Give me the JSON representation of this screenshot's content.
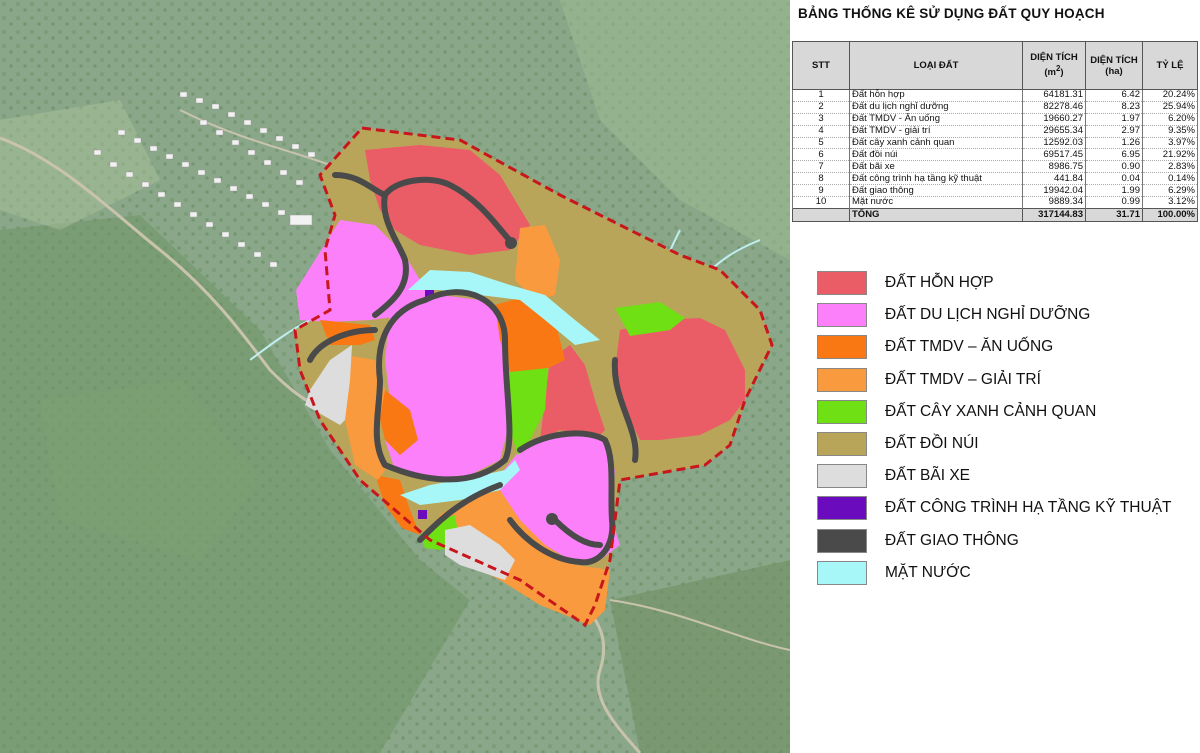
{
  "table": {
    "title": "BẢNG THỐNG KÊ SỬ DỤNG ĐẤT QUY HOẠCH",
    "headers": {
      "stt": "STT",
      "loai_dat": "LOẠI ĐẤT",
      "dien_tich_m2": "DIỆN TÍCH",
      "dien_tich_m2_unit": "(m",
      "dien_tich_m2_sup": "2",
      "dien_tich_m2_close": ")",
      "dien_tich_ha": "DIỆN TÍCH",
      "dien_tich_ha_unit": "(ha)",
      "ty_le": "TỶ LỆ"
    },
    "rows": [
      {
        "stt": "1",
        "name": "Đất hỗn hợp",
        "m2": "64181.31",
        "ha": "6.42",
        "pct": "20.24%"
      },
      {
        "stt": "2",
        "name": "Đất du lịch nghỉ dưỡng",
        "m2": "82278.46",
        "ha": "8.23",
        "pct": "25.94%"
      },
      {
        "stt": "3",
        "name": "Đất TMDV - Ăn uống",
        "m2": "19660.27",
        "ha": "1.97",
        "pct": "6.20%"
      },
      {
        "stt": "4",
        "name": "Đất TMDV - giải trí",
        "m2": "29655.34",
        "ha": "2.97",
        "pct": "9.35%"
      },
      {
        "stt": "5",
        "name": "Đất cây xanh cảnh quan",
        "m2": "12592.03",
        "ha": "1.26",
        "pct": "3.97%"
      },
      {
        "stt": "6",
        "name": "Đất đồi núi",
        "m2": "69517.45",
        "ha": "6.95",
        "pct": "21.92%"
      },
      {
        "stt": "7",
        "name": "Đất bãi xe",
        "m2": "8986.75",
        "ha": "0.90",
        "pct": "2.83%"
      },
      {
        "stt": "8",
        "name": "Đất công trình hạ tầng kỹ thuật",
        "m2": "441.84",
        "ha": "0.04",
        "pct": "0.14%"
      },
      {
        "stt": "9",
        "name": "Đất giao thông",
        "m2": "19942.04",
        "ha": "1.99",
        "pct": "6.29%"
      },
      {
        "stt": "10",
        "name": "Mặt nước",
        "m2": "9889.34",
        "ha": "0.99",
        "pct": "3.12%"
      }
    ],
    "total": {
      "label": "TỔNG",
      "m2": "317144.83",
      "ha": "31.71",
      "pct": "100.00%"
    }
  },
  "legend": [
    {
      "label": "ĐẤT HỖN HỢP",
      "color": "#ea5d67"
    },
    {
      "label": "ĐẤT DU LỊCH NGHỈ DƯỠNG",
      "color": "#fb80f9"
    },
    {
      "label": "ĐẤT TMDV – ĂN UỐNG",
      "color": "#f97813"
    },
    {
      "label": "ĐẤT TMDV – GIẢI TRÍ",
      "color": "#f99a3e"
    },
    {
      "label": "ĐẤT CÂY XANH CẢNH QUAN",
      "color": "#6ee014"
    },
    {
      "label": "ĐẤT ĐỒI NÚI",
      "color": "#b9a55a"
    },
    {
      "label": "ĐẤT BÃI XE",
      "color": "#dddddd"
    },
    {
      "label": "ĐẤT CÔNG TRÌNH HẠ TẦNG KỸ THUẬT",
      "color": "#6a0bbd"
    },
    {
      "label": "ĐẤT GIAO THÔNG",
      "color": "#4a4a4a"
    },
    {
      "label": "MẶT NƯỚC",
      "color": "#a8f7f8"
    }
  ],
  "map": {
    "boundary_color": "#c8161c",
    "satellite_base_color": "#8aa889"
  }
}
